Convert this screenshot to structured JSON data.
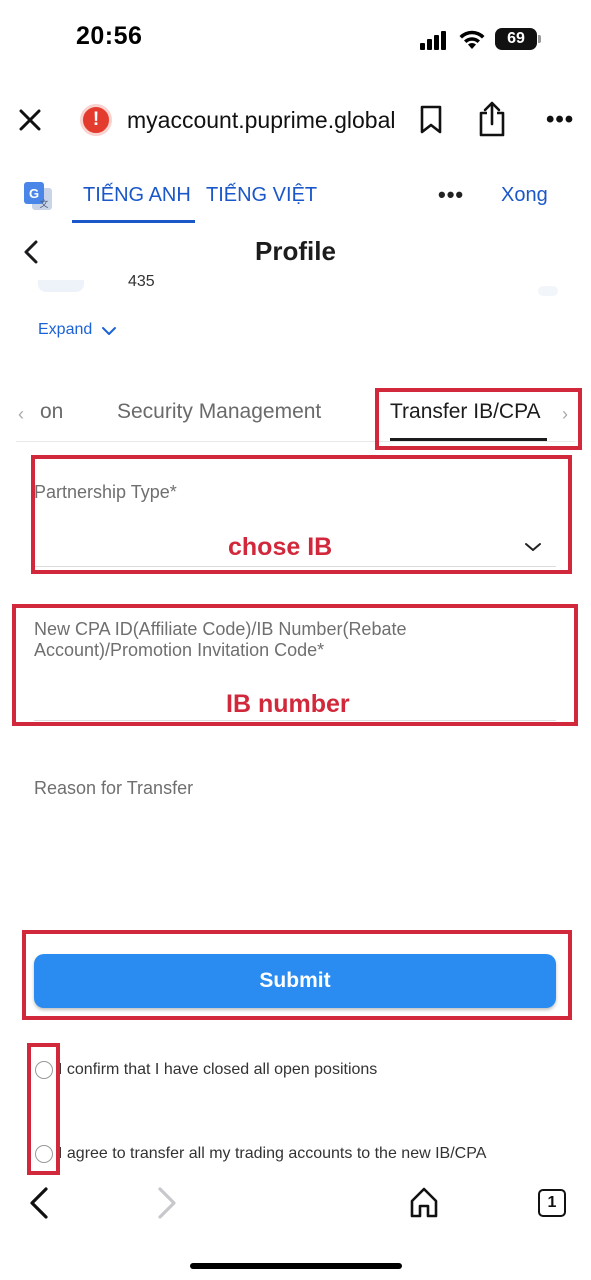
{
  "status_bar": {
    "time": "20:56",
    "battery": "69"
  },
  "browser": {
    "url": "myaccount.puprime.global"
  },
  "translate_bar": {
    "lang_source": "TIẾNG ANH",
    "lang_target": "TIẾNG VIỆT",
    "done": "Xong"
  },
  "header": {
    "title": "Profile",
    "partial_text": "435"
  },
  "expand": {
    "label": "Expand"
  },
  "tabs": [
    {
      "label": "on"
    },
    {
      "label": "Security Management"
    },
    {
      "label": "Transfer IB/CPA",
      "active": true
    }
  ],
  "form": {
    "partnership_type_label": "Partnership Type*",
    "new_id_label_line1": "New CPA ID(Affiliate Code)/IB Number(Rebate",
    "new_id_label_line2": "Account)/Promotion Invitation Code*",
    "reason_label": "Reason for Transfer",
    "submit_label": "Submit",
    "confirm_positions": "I confirm that I have closed all open positions",
    "confirm_transfer": "I agree to transfer all my trading accounts to the new IB/CPA"
  },
  "annotations": {
    "choose_ib": "chose IB",
    "ib_number": "IB number",
    "color": "#d1293b"
  },
  "toolbar": {
    "tab_count": "1"
  },
  "colors": {
    "accent": "#2a8cf0",
    "link": "#1a57c8"
  }
}
